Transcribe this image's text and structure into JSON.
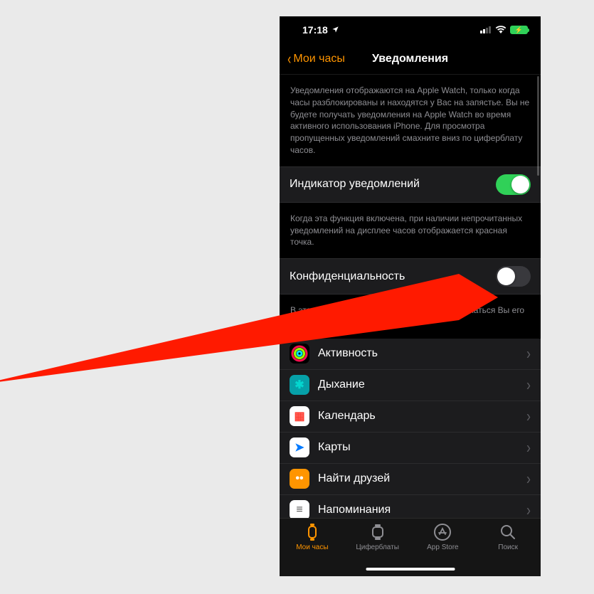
{
  "status_bar": {
    "time": "17:18",
    "has_location": true
  },
  "nav": {
    "back_label": "Мои часы",
    "title": "Уведомления"
  },
  "intro_desc": "Уведомления отображаются на Apple Watch, только когда часы разблокированы и находятся у Вас на запястье. Вы не будете получать уведомления на Apple Watch во время активного использования iPhone. Для просмотра пропущенных уведомлений смахните вниз по циферблату часов.",
  "toggle1": {
    "label": "Индикатор уведомлений",
    "on": true,
    "desc": "Когда эта функция включена, при наличии непрочитанных уведомлений на дисплее часов отображается красная точка."
  },
  "toggle2": {
    "label": "Конфиденциальность",
    "on": false,
    "desc": "В этом режиме подробно                                         ия не будут отображаться              Вы его не к              есь."
  },
  "apps": [
    {
      "label": "Активность",
      "icon_name": "activity-rings-icon",
      "bg": "#000",
      "glyph": "◉",
      "color": "#ff3b30"
    },
    {
      "label": "Дыхание",
      "icon_name": "breathe-icon",
      "bg": "#06a0a8",
      "glyph": "✱",
      "color": "#04d6cf"
    },
    {
      "label": "Календарь",
      "icon_name": "calendar-icon",
      "bg": "#fff",
      "glyph": "▦",
      "color": "#ff3b30"
    },
    {
      "label": "Карты",
      "icon_name": "maps-icon",
      "bg": "#fff",
      "glyph": "➤",
      "color": "#007aff"
    },
    {
      "label": "Найти друзей",
      "icon_name": "find-friends-icon",
      "bg": "#ff9500",
      "glyph": "••",
      "color": "#fff"
    },
    {
      "label": "Напоминания",
      "icon_name": "reminders-icon",
      "bg": "#fff",
      "glyph": "≡",
      "color": "#555"
    }
  ],
  "tabs": [
    {
      "label": "Мои часы",
      "icon_name": "watch-icon",
      "active": true
    },
    {
      "label": "Циферблаты",
      "icon_name": "watchface-icon",
      "active": false
    },
    {
      "label": "App Store",
      "icon_name": "appstore-icon",
      "active": false
    },
    {
      "label": "Поиск",
      "icon_name": "search-icon",
      "active": false
    }
  ],
  "annotation": {
    "color": "#ff1a00"
  }
}
